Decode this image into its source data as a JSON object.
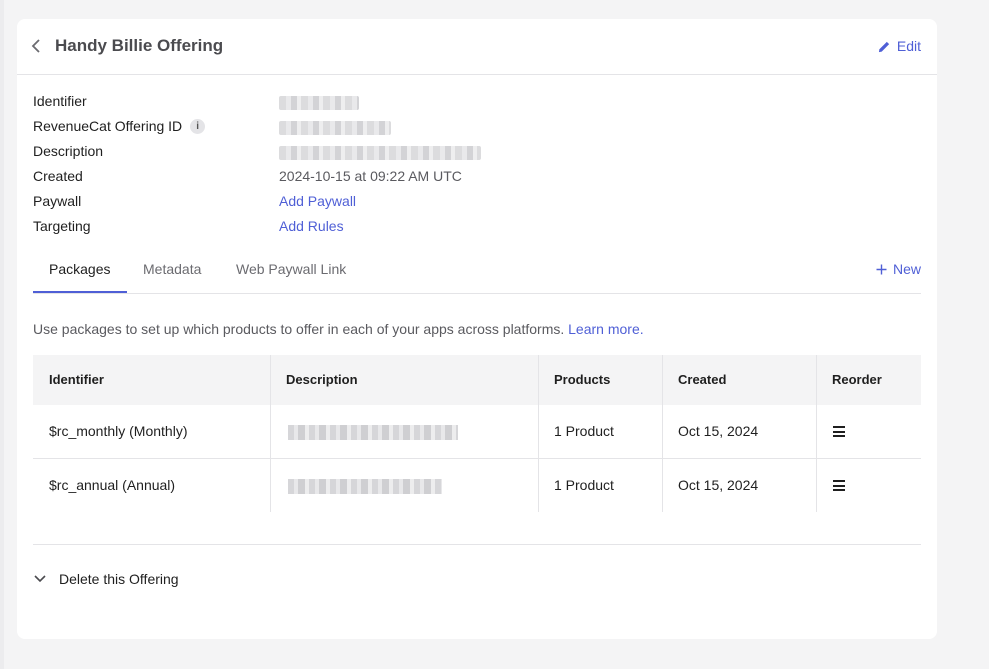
{
  "header": {
    "title": "Handy Billie Offering",
    "edit_label": "Edit"
  },
  "details": [
    {
      "label": "Identifier",
      "value": "",
      "redacted": true
    },
    {
      "label": "RevenueCat Offering ID",
      "value": "",
      "redacted": true
    },
    {
      "label": "Description",
      "value": "",
      "redacted": true
    },
    {
      "label": "Created",
      "value": "2024-10-15 at 09:22 AM UTC"
    },
    {
      "label": "Paywall",
      "value": "Add Paywall",
      "link": true
    },
    {
      "label": "Targeting",
      "value": "Add Rules",
      "link": true
    }
  ],
  "tabs": [
    {
      "label": "Packages",
      "active": true
    },
    {
      "label": "Metadata",
      "active": false
    },
    {
      "label": "Web Paywall Link",
      "active": false
    }
  ],
  "new_label": "New",
  "packages_intro": {
    "text": "Use packages to set up which products to offer in each of your apps across platforms.",
    "link": "Learn more."
  },
  "table": {
    "columns": [
      "Identifier",
      "Description",
      "Products",
      "Created",
      "Reorder"
    ],
    "rows": [
      {
        "identifier": "$rc_monthly (Monthly)",
        "description": "",
        "products": "1 Product",
        "created": "Oct 15, 2024"
      },
      {
        "identifier": "$rc_annual (Annual)",
        "description": "",
        "products": "1 Product",
        "created": "Oct 15, 2024"
      }
    ]
  },
  "delete_label": "Delete this Offering",
  "colors": {
    "accent": "#4f5fd6",
    "background": "#f4f4f5",
    "card": "#ffffff"
  }
}
